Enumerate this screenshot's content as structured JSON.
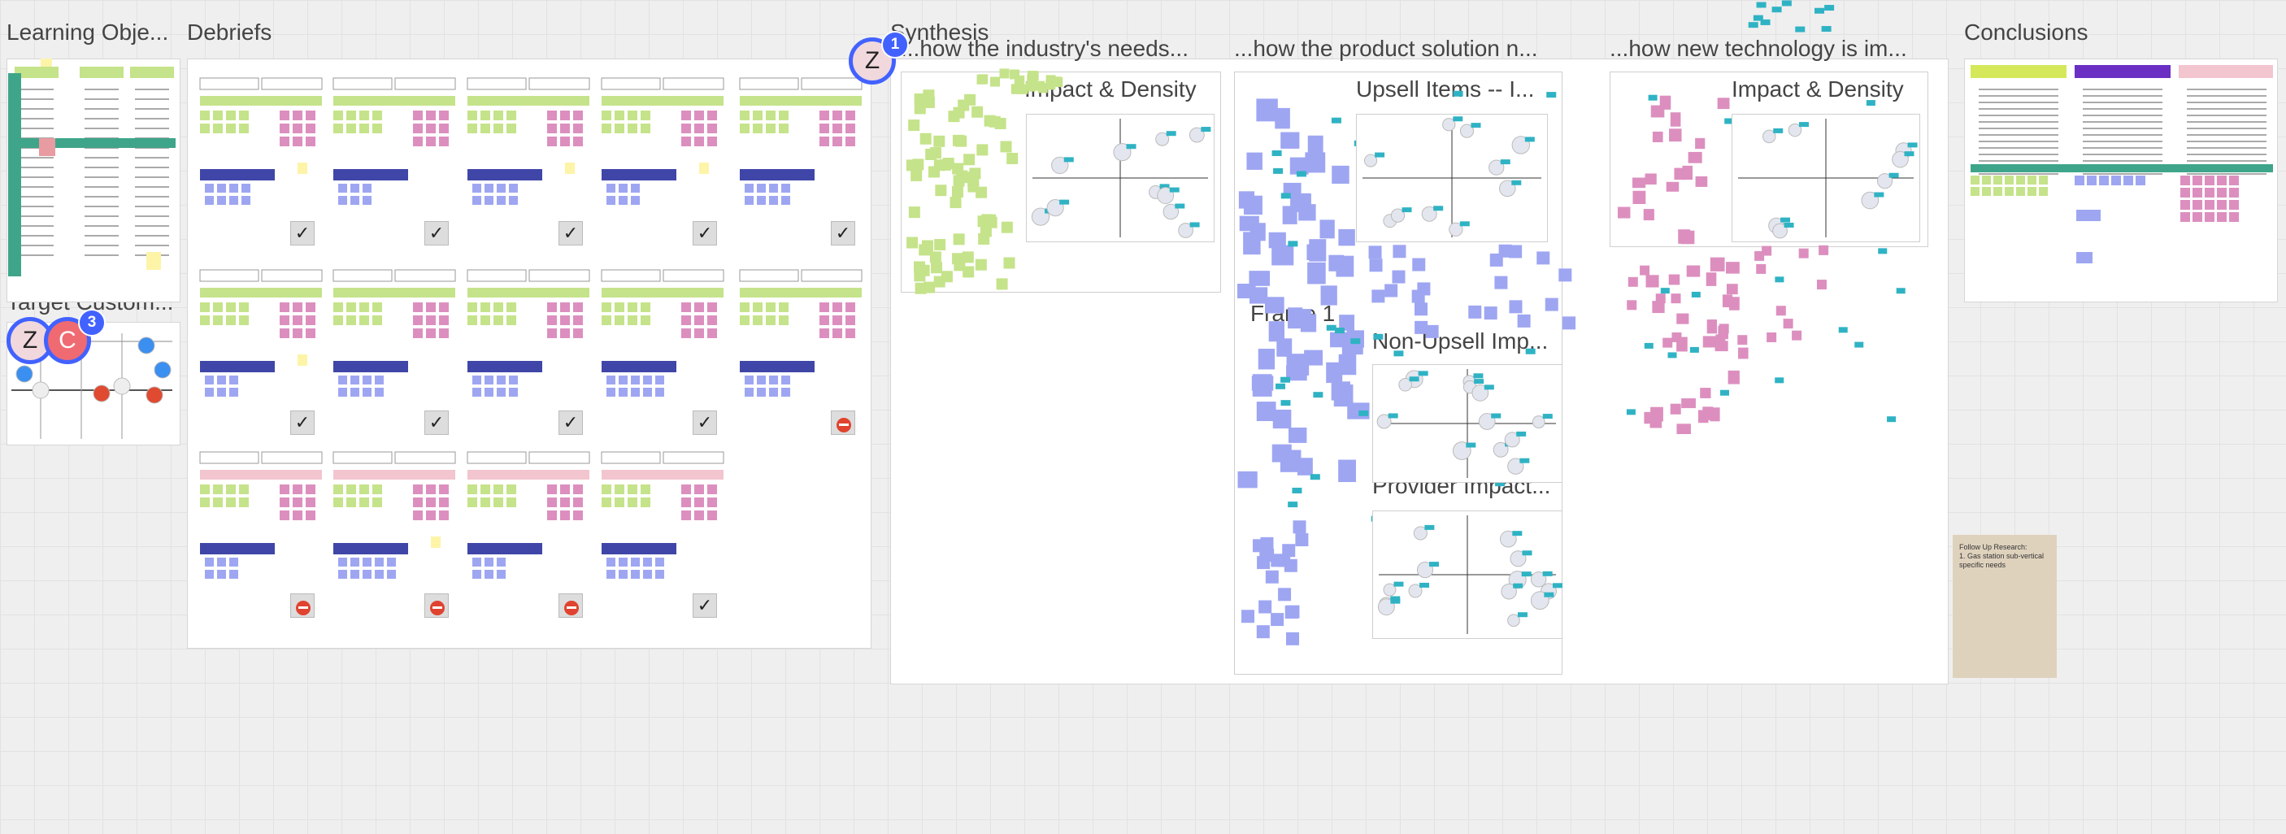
{
  "frames": {
    "learning_objectives": "Learning Obje...",
    "debriefs": "Debriefs",
    "target_customer": "Target Custom...",
    "synthesis": "Synthesis",
    "industry_needs": "...how the industry's needs...",
    "product_solution": "...how the product solution n...",
    "new_technology": "...how new technology is im...",
    "conclusions": "Conclusions"
  },
  "subframes": {
    "impact_density_1": "Impact & Density",
    "upsell_items": "Upsell Items -- I...",
    "impact_density_2": "Impact & Density",
    "frame_1": "Frame 1",
    "non_upsell": "Non-Upsell Imp...",
    "provider_impact": "Provider Impact..."
  },
  "collaborators": [
    {
      "initial": "Z",
      "badge": "1"
    },
    {
      "initial": "Z",
      "badge": ""
    },
    {
      "initial": "C",
      "badge": "3"
    }
  ],
  "sticky_note": {
    "line1": "Follow Up Research:",
    "line2": "1. Gas station sub-vertical",
    "line3": "specific needs"
  },
  "check_glyph": "✓",
  "colors": {
    "sticky_green": "#c5e38a",
    "sticky_pink": "#dc8fbf",
    "sticky_purple": "#9ea6f2",
    "sticky_yellow": "#fdf4a8",
    "navy_bar": "#3f46a8",
    "teal_tag": "#2fb3c4",
    "collab_blue": "#4262ff"
  }
}
